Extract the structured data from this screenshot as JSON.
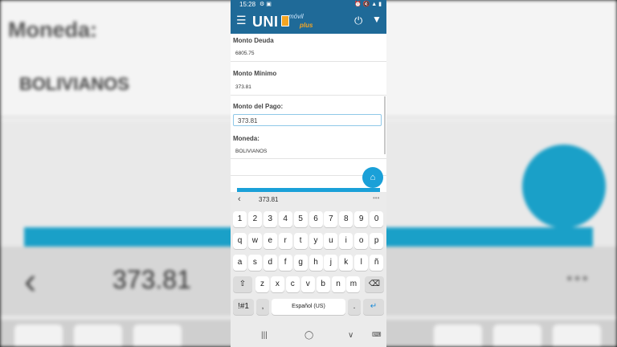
{
  "background": {
    "label_moneda": "Moneda:",
    "value_moneda": "BOLIVIANOS",
    "suggestion_value": "373.81"
  },
  "status_bar": {
    "time": "15:28"
  },
  "app_bar": {
    "logo_text": "UNI",
    "logo_sub": "móvil",
    "logo_plus": "plus",
    "menu_icon": "hamburger-menu-icon",
    "power_icon": "power-icon",
    "chevron_icon": "chevron-down-icon"
  },
  "form": {
    "monto_deuda_label": "Monto Deuda",
    "monto_deuda_value": "6805.75",
    "monto_minimo_label": "Monto Mínimo",
    "monto_minimo_value": "373.81",
    "monto_pago_label": "Monto del Pago:",
    "monto_pago_value": "373.81",
    "moneda_label": "Moneda:",
    "moneda_value": "BOLIVIANOS"
  },
  "fab": {
    "icon": "home-icon"
  },
  "keyboard": {
    "suggestion": "373.81",
    "row_numbers": [
      "1",
      "2",
      "3",
      "4",
      "5",
      "6",
      "7",
      "8",
      "9",
      "0"
    ],
    "row1": [
      "q",
      "w",
      "e",
      "r",
      "t",
      "y",
      "u",
      "i",
      "o",
      "p"
    ],
    "row2": [
      "a",
      "s",
      "d",
      "f",
      "g",
      "h",
      "j",
      "k",
      "l",
      "ñ"
    ],
    "row3": [
      "z",
      "x",
      "c",
      "v",
      "b",
      "n",
      "m"
    ],
    "symbols_key": "!#1",
    "comma_key": ",",
    "space_key": "Español (US)",
    "period_key": "."
  },
  "accent_color": "#1f6a98",
  "fab_color": "#1aa0d8"
}
